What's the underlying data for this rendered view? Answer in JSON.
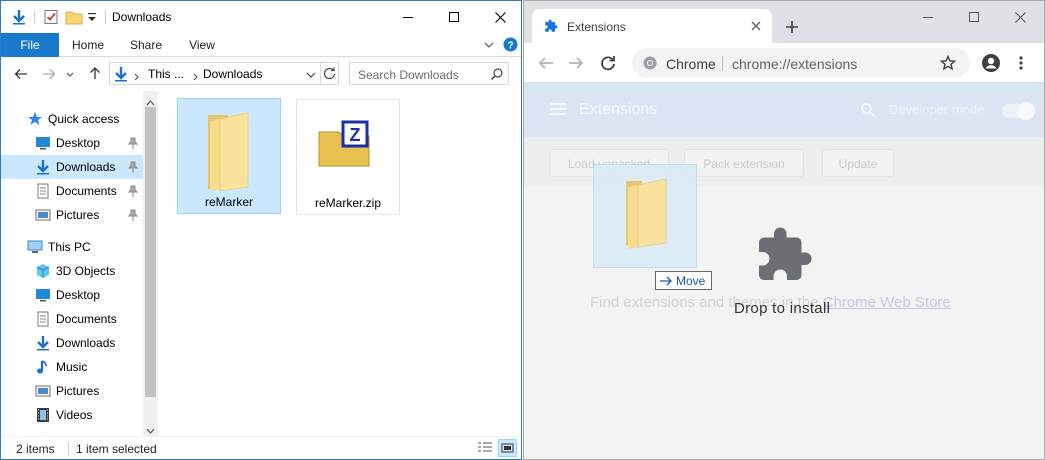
{
  "explorer": {
    "title": "Downloads",
    "ribbon_tabs": {
      "file": "File",
      "home": "Home",
      "share": "Share",
      "view": "View"
    },
    "address": {
      "segment1": "This ...",
      "segment2": "Downloads"
    },
    "search": {
      "placeholder": "Search Downloads"
    },
    "nav": {
      "quick_access": "Quick access",
      "qa_desktop": "Desktop",
      "qa_downloads": "Downloads",
      "qa_documents": "Documents",
      "qa_pictures": "Pictures",
      "this_pc": "This PC",
      "pc_3d": "3D Objects",
      "pc_desktop": "Desktop",
      "pc_documents": "Documents",
      "pc_downloads": "Downloads",
      "pc_music": "Music",
      "pc_pictures": "Pictures",
      "pc_videos": "Videos"
    },
    "files": [
      {
        "name": "reMarker",
        "type": "folder",
        "selected": true
      },
      {
        "name": "reMarker.zip",
        "type": "zip",
        "selected": false
      }
    ],
    "status": {
      "count": "2 items",
      "selected": "1 item selected"
    }
  },
  "chrome": {
    "tab_title": "Extensions",
    "omnibox": {
      "site": "Chrome",
      "url": "chrome://extensions"
    },
    "page": {
      "header_title": "Extensions",
      "developer_mode": "Developer mode",
      "buttons": {
        "load": "Load unpacked",
        "pack": "Pack extension",
        "update": "Update"
      },
      "find_text": "Find extensions and themes in the ",
      "store_link": "Chrome Web Store",
      "drop_text": "Drop to install"
    }
  },
  "drag": {
    "move_label": "Move"
  },
  "colors": {
    "accent": "#1979ca",
    "selection": "#cce8ff",
    "chrome_frame": "#dee1e6"
  }
}
